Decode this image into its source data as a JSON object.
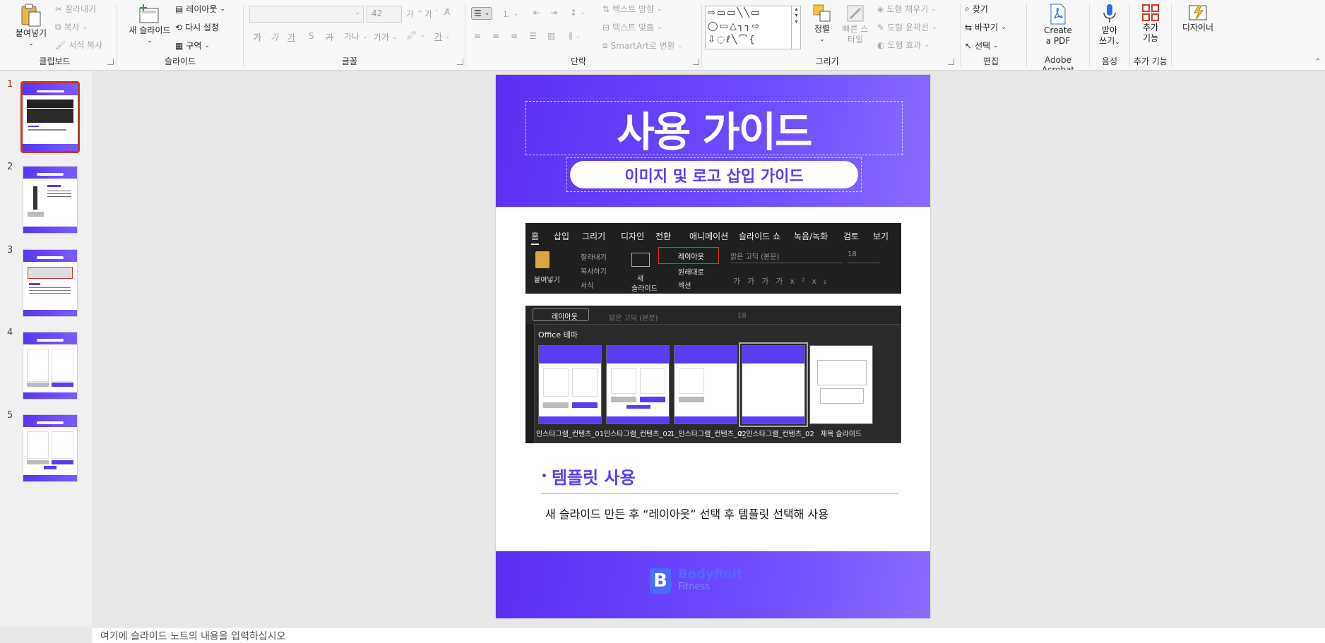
{
  "ribbon": {
    "clipboard": {
      "paste": "붙여넣기",
      "cut": "잘라내기",
      "copy": "복사",
      "format_painter": "서식 복사",
      "label": "클립보드"
    },
    "slides": {
      "new_slide": "새 슬라이드",
      "layout": "레이아웃",
      "reset": "다시 설정",
      "section": "구역",
      "label": "슬라이드"
    },
    "font": {
      "label": "글꼴",
      "size": "42",
      "bold": "가",
      "italic": "가",
      "underline": "가",
      "shadow": "S",
      "strike": "가",
      "spacing": "가나",
      "case": "가가",
      "highlight": "가",
      "color": "가"
    },
    "paragraph": {
      "label": "단락",
      "text_direction": "텍스트 방향",
      "align_text": "텍스트 맞춤",
      "smartart": "SmartArt로 변환"
    },
    "drawing": {
      "label": "그리기",
      "arrange": "정렬",
      "quick_styles": "빠른 스타일",
      "shape_fill": "도형 채우기",
      "shape_outline": "도형 윤곽선",
      "shape_effects": "도형 효과"
    },
    "editing": {
      "label": "편집",
      "find": "찾기",
      "replace": "바꾸기",
      "select": "선택"
    },
    "acrobat": {
      "label": "Adobe Acrobat",
      "create_pdf_1": "Create",
      "create_pdf_2": "a PDF"
    },
    "voice": {
      "label": "음성",
      "dictate_1": "받아",
      "dictate_2": "쓰기"
    },
    "addins": {
      "label": "추가 기능",
      "addins_1": "추가",
      "addins_2": "기능"
    },
    "designer": {
      "label": "디자이너"
    }
  },
  "thumbnails": [
    {
      "num": "1",
      "selected": true
    },
    {
      "num": "2",
      "selected": false
    },
    {
      "num": "3",
      "selected": false
    },
    {
      "num": "4",
      "selected": false
    },
    {
      "num": "5",
      "selected": false
    }
  ],
  "slide": {
    "title": "사용 가이드",
    "subtitle": "이미지 및 로고 삽입 가이드",
    "section_heading": "템플릿 사용",
    "section_text": "새 슬라이드 만든 후 “레이아웃” 선택 후 템플릿 선택해 사용",
    "logo_mark": "B",
    "logo_text_1": "Bodyfinit",
    "logo_text_2": "Fitness"
  },
  "screenshot1": {
    "tabs": [
      "홈",
      "삽입",
      "그리기",
      "디자인",
      "전환",
      "애니메이션",
      "슬라이드 쇼",
      "녹음/녹화",
      "검토",
      "보기"
    ],
    "paste": "붙여넣기",
    "cut": "잘라내기",
    "copy": "복사하기",
    "format": "서식",
    "new_slide_1": "새",
    "new_slide_2": "슬라이드",
    "layout": "레이아웃",
    "reset": "원래대로",
    "section": "섹션",
    "font_name": "맑은 고딕 (본문)",
    "font_size": "18"
  },
  "screenshot2": {
    "layout_button": "레이아웃",
    "font_name": "맑은 고딕 (본문)",
    "font_size": "18",
    "theme_label": "Office 테마",
    "layouts": [
      "인스타그램_컨텐츠_01",
      "인스타그램_컨텐츠_02",
      "1_인스타그램_컨텐츠_02",
      "2_인스타그램_컨텐츠_02",
      "제목 슬라이드"
    ]
  },
  "notes": {
    "placeholder": "여기에 슬라이드 노트의 내용을 입력하십시오"
  },
  "colors": {
    "accent": "#5b3cf0",
    "selected_border": "#c0392b"
  }
}
